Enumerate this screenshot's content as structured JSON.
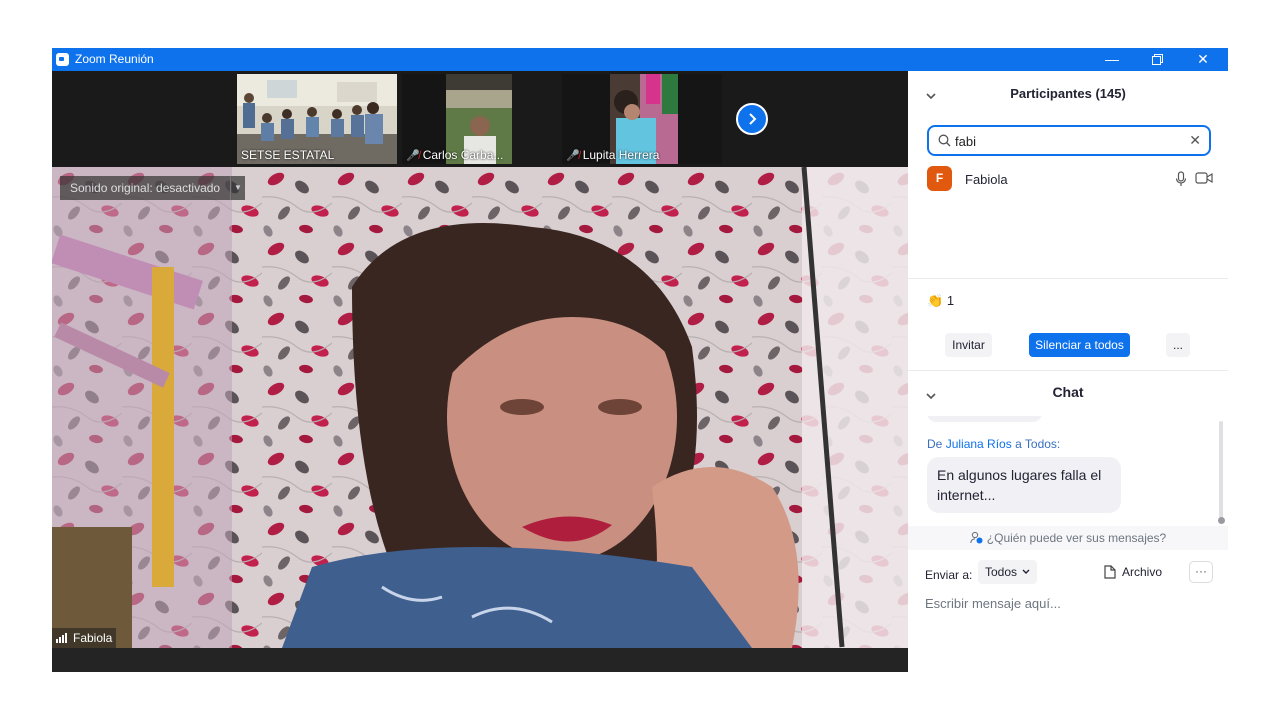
{
  "window": {
    "title": "Zoom Reunión"
  },
  "thumbnails": [
    {
      "label": "SETSE ESTATAL",
      "muted": false
    },
    {
      "label": "Carlos Carba...",
      "muted": true
    },
    {
      "label": "Lupita Herrera",
      "muted": true
    }
  ],
  "main_video": {
    "sound_label": "Sonido original: desactivado",
    "speaker": "Fabiola"
  },
  "participants": {
    "title": "Participantes (145)",
    "search_value": "fabi",
    "list": [
      {
        "initial": "F",
        "name": "Fabiola",
        "avatar_color": "#e0590f"
      }
    ],
    "reactions": {
      "emoji": "👏",
      "count": "1"
    },
    "invite_label": "Invitar",
    "mute_all_label": "Silenciar a todos",
    "more_label": "..."
  },
  "chat": {
    "title": "Chat",
    "sender_prefix": "De",
    "sender_name": "Juliana Ríos",
    "sender_mid": "a",
    "sender_target": "Todos:",
    "message": "En algunos lugares falla el internet...",
    "who_can_see": "¿Quién puede ver sus mensajes?",
    "send_to_label": "Enviar a:",
    "send_to_value": "Todos",
    "file_label": "Archivo",
    "more_label": "···",
    "input_placeholder": "Escribir mensaje aquí..."
  },
  "colors": {
    "accent": "#0e72ed",
    "muted_red": "#e02828"
  }
}
